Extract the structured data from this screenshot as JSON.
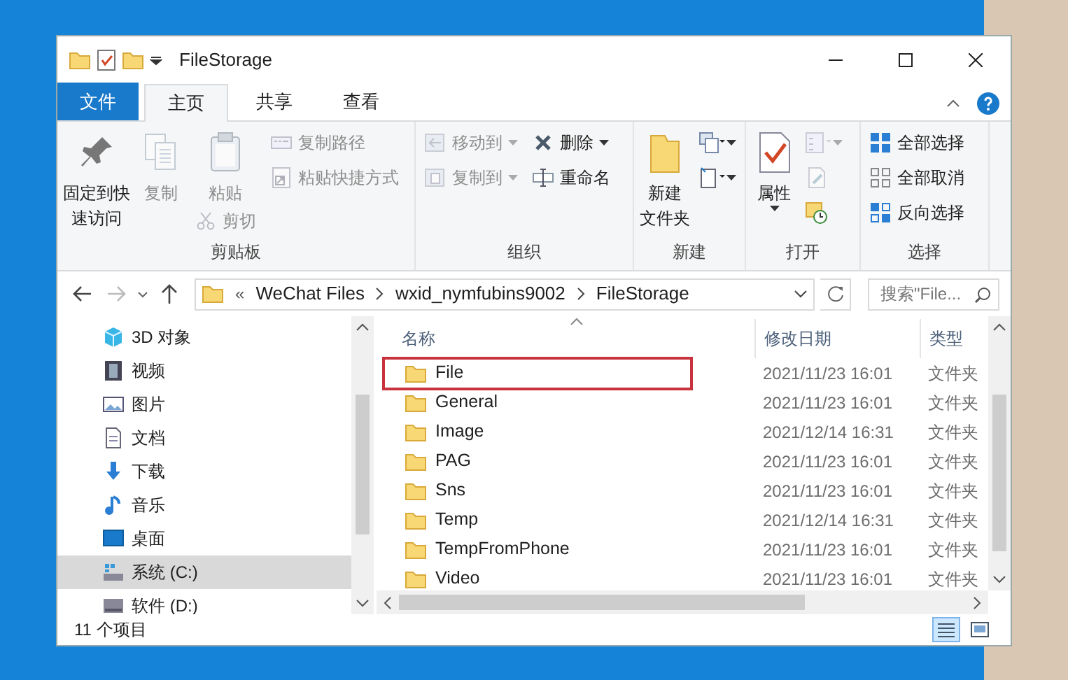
{
  "window": {
    "title": "FileStorage"
  },
  "tabs": [
    {
      "label": "文件",
      "kind": "file",
      "selected": false
    },
    {
      "label": "主页",
      "kind": "tab",
      "selected": true
    },
    {
      "label": "共享",
      "kind": "tab",
      "selected": false
    },
    {
      "label": "查看",
      "kind": "tab",
      "selected": false
    }
  ],
  "ribbon_groups": [
    {
      "label": "剪贴板",
      "columns": [
        [
          {
            "kind": "large",
            "lines": [
              "固定到快",
              "速访问"
            ],
            "disabled": false
          }
        ],
        [
          {
            "kind": "large",
            "lines": [
              "复制"
            ],
            "disabled": true
          }
        ],
        [
          {
            "kind": "large",
            "lines": [
              "粘贴"
            ],
            "disabled": true
          },
          {
            "kind": "small",
            "label": "剪切",
            "disabled": true
          }
        ],
        [
          {
            "kind": "small",
            "label": "复制路径",
            "disabled": true
          },
          {
            "kind": "small",
            "label": "粘贴快捷方式",
            "disabled": true
          }
        ]
      ]
    },
    {
      "label": "组织",
      "columns": [
        [
          {
            "kind": "small",
            "label": "移动到",
            "dropdown": true,
            "disabled": true
          },
          {
            "kind": "small",
            "label": "复制到",
            "dropdown": true,
            "disabled": true
          }
        ],
        [
          {
            "kind": "small",
            "label": "删除",
            "dropdown": true,
            "disabled": false
          },
          {
            "kind": "small",
            "label": "重命名",
            "disabled": false
          }
        ]
      ]
    },
    {
      "label": "新建",
      "columns": [
        [
          {
            "kind": "large",
            "lines": [
              "新建",
              "文件夹"
            ],
            "disabled": false
          }
        ],
        [
          {
            "kind": "icon",
            "dropdown": true,
            "disabled": false
          },
          {
            "kind": "icon",
            "dropdown": true,
            "disabled": false
          }
        ]
      ]
    },
    {
      "label": "打开",
      "columns": [
        [
          {
            "kind": "large",
            "lines": [
              "属性"
            ],
            "dropdown": true,
            "disabled": false
          }
        ],
        [
          {
            "kind": "icon",
            "dropdown": true,
            "disabled": true
          },
          {
            "kind": "icon",
            "disabled": true
          },
          {
            "kind": "icon",
            "disabled": false
          }
        ]
      ]
    },
    {
      "label": "选择",
      "columns": [
        [
          {
            "kind": "small",
            "label": "全部选择",
            "disabled": false
          },
          {
            "kind": "small",
            "label": "全部取消",
            "disabled": false
          },
          {
            "kind": "small",
            "label": "反向选择",
            "disabled": false
          }
        ]
      ]
    }
  ],
  "address_bar": {
    "overflow": "«",
    "crumbs": [
      "WeChat Files",
      "wxid_nymfubins9002",
      "FileStorage"
    ]
  },
  "search": {
    "placeholder": "搜索\"File..."
  },
  "nav_pane": {
    "items": [
      {
        "label": "3D 对象",
        "selected": false
      },
      {
        "label": "视频",
        "selected": false
      },
      {
        "label": "图片",
        "selected": false
      },
      {
        "label": "文档",
        "selected": false
      },
      {
        "label": "下载",
        "selected": false
      },
      {
        "label": "音乐",
        "selected": false
      },
      {
        "label": "桌面",
        "selected": false
      },
      {
        "label": "系统 (C:)",
        "selected": true
      },
      {
        "label": "软件 (D:)",
        "selected": false
      }
    ]
  },
  "file_list": {
    "columns": [
      "名称",
      "修改日期",
      "类型"
    ],
    "rows": [
      {
        "name": "File",
        "modified": "2021/11/23 16:01",
        "type": "文件夹",
        "highlighted": true
      },
      {
        "name": "General",
        "modified": "2021/11/23 16:01",
        "type": "文件夹",
        "highlighted": false
      },
      {
        "name": "Image",
        "modified": "2021/12/14 16:31",
        "type": "文件夹",
        "highlighted": false
      },
      {
        "name": "PAG",
        "modified": "2021/11/23 16:01",
        "type": "文件夹",
        "highlighted": false
      },
      {
        "name": "Sns",
        "modified": "2021/11/23 16:01",
        "type": "文件夹",
        "highlighted": false
      },
      {
        "name": "Temp",
        "modified": "2021/12/14 16:31",
        "type": "文件夹",
        "highlighted": false
      },
      {
        "name": "TempFromPhone",
        "modified": "2021/11/23 16:01",
        "type": "文件夹",
        "highlighted": false
      },
      {
        "name": "Video",
        "modified": "2021/11/23 16:01",
        "type": "文件夹",
        "highlighted": false
      }
    ]
  },
  "status_bar": {
    "item_count": "11 个项目"
  }
}
